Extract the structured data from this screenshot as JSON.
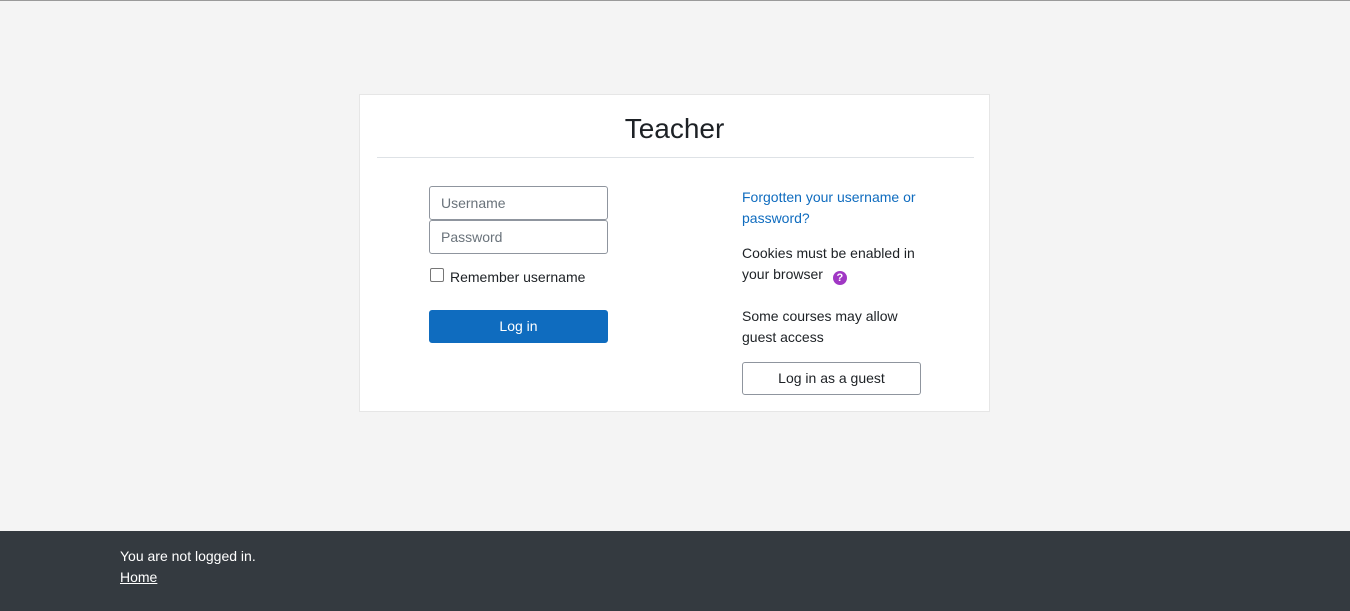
{
  "login": {
    "title": "Teacher",
    "username_placeholder": "Username",
    "password_placeholder": "Password",
    "remember_label": "Remember username",
    "remember_checked": false,
    "login_button": "Log in"
  },
  "side": {
    "forgot_link": "Forgotten your username or password?",
    "cookies_text": "Cookies must be enabled in your browser",
    "cookies_help_icon": "question-circle-icon",
    "guest_text": "Some courses may allow guest access",
    "guest_button": "Log in as a guest"
  },
  "footer": {
    "status": "You are not logged in.",
    "home_link": "Home"
  },
  "colors": {
    "primary": "#0f6cbf",
    "help_icon": "#a037c4",
    "footer_bg": "#343a40",
    "page_bg": "#f4f4f4"
  }
}
